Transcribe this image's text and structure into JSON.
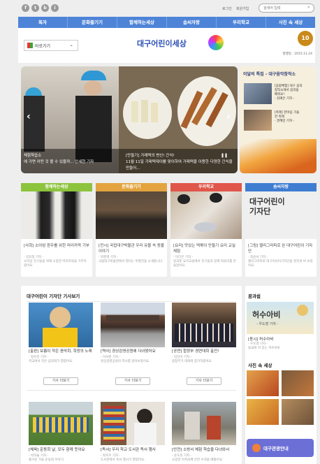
{
  "topbar": {
    "sns": [
      "f",
      "t",
      "b",
      "i"
    ],
    "links": [
      "로그인",
      "회원가입"
    ],
    "search_placeholder": "검색어 입력"
  },
  "nav": [
    "독자",
    "문화즐기기",
    "함께하는세상",
    "솜씨자랑",
    "우리학교",
    "사진 속 세상"
  ],
  "header": {
    "menu_label": "바로가기",
    "logo_text": "대구어린이세상",
    "date": "발행일 : 2015.11.24",
    "anniv": "10"
  },
  "hero": {
    "caption_left": "체험학습소\n에 가면 어떤 것 볼 수 있을까...    안세현 기자",
    "caption_mid": "[만들기] 가래떡의 변신! 간식!\n11월 11일 가래떡데이를 맞이하여 가래떡을 이용한 다양한 간식을 만들어...",
    "sidebar_title": "이달의 특집 - 대구음악창작소",
    "side1": "[음향체험] 대구 음악\n창작소에서 음악을\n배워요!\n- 김예은 기자 -",
    "side2": "[축제] 한마음 가을\n한 축제\n- 권혜민 기자 -"
  },
  "topics": [
    {
      "label": "함께하는세상",
      "title": "[사회] 소아암 환우를 위한 머리카락 기부",
      "meta": "- 김효정 기자 -\n소아암 친구들을 위해 소중한 머리카락을 기부하였어요."
    },
    {
      "label": "문화즐기기",
      "title": "[전시] 국립대구박물관 우리 유물 속 동물 이야기",
      "meta": "- 박준영 기자 -\n국립대구박물관에서 열리는 특별전을 소개합니다."
    },
    {
      "label": "우리학교",
      "title": "[요리] 맛있는 떡볶이 만들기 요리 교실 체험",
      "meta": "- 이다은 기자 -\n방과후 요리교실에서 친구들과 함께 떡볶이를 만들었어요."
    },
    {
      "label": "솜씨자랑",
      "title": "[그림] 캘리그라피로 쓴 대구어린이 기자단",
      "meta": "- 최윤서 기자 -\n캘리그라피로 대구어린이기자단을 멋지게 써 보았어요."
    }
  ],
  "reporters": {
    "heading": "대구어린이 기자단 기사보기",
    "more_label": "기사 더보기",
    "articles": [
      {
        "title": "[출판] 보름이 작은 음악회, 희망의 노래",
        "meta": "- 정유진 기자 -\n학교에서 작은 음악회가 열렸어요."
      },
      {
        "title": "[역사] 경상감영공원에 다녀왔어요",
        "meta": "- 이서준 기자 -\n경상감영공원의 역사를 알아보았어요."
      },
      {
        "title": "[공연] 합창부 경연대회 출전!",
        "meta": "- 김민아 기자 -\n합창부가 대회에 참가하였어요."
      },
      {
        "title": "[체육] 운동회 날, 모두 함께 웃어요",
        "meta": "- 박하늘 기자 -\n즐거운 가을 운동회 이야기."
      },
      {
        "title": "[독서] 우리 학교 도서관 독서 행사",
        "meta": "- 최지우 기자 -\n도서관에서 독서 행사가 열렸어요."
      },
      {
        "title": "[안전] 소방서 체험 학습을 다녀와서",
        "meta": "- 윤도현 기자 -\n소방관 아저씨께 안전 수칙을 배웠어요."
      }
    ]
  },
  "cartoon": {
    "heading": "꿈과쉼",
    "banner_text": "허수아비",
    "sub": "- 우도영 기자 -",
    "title": "[동시] 허수아비",
    "meta": "- 우도영 기자 -\n들녘에 서 있는 허수아비"
  },
  "photo_world": {
    "heading": "사진 속 세상"
  },
  "tourism": {
    "label": "대구관광안내"
  }
}
